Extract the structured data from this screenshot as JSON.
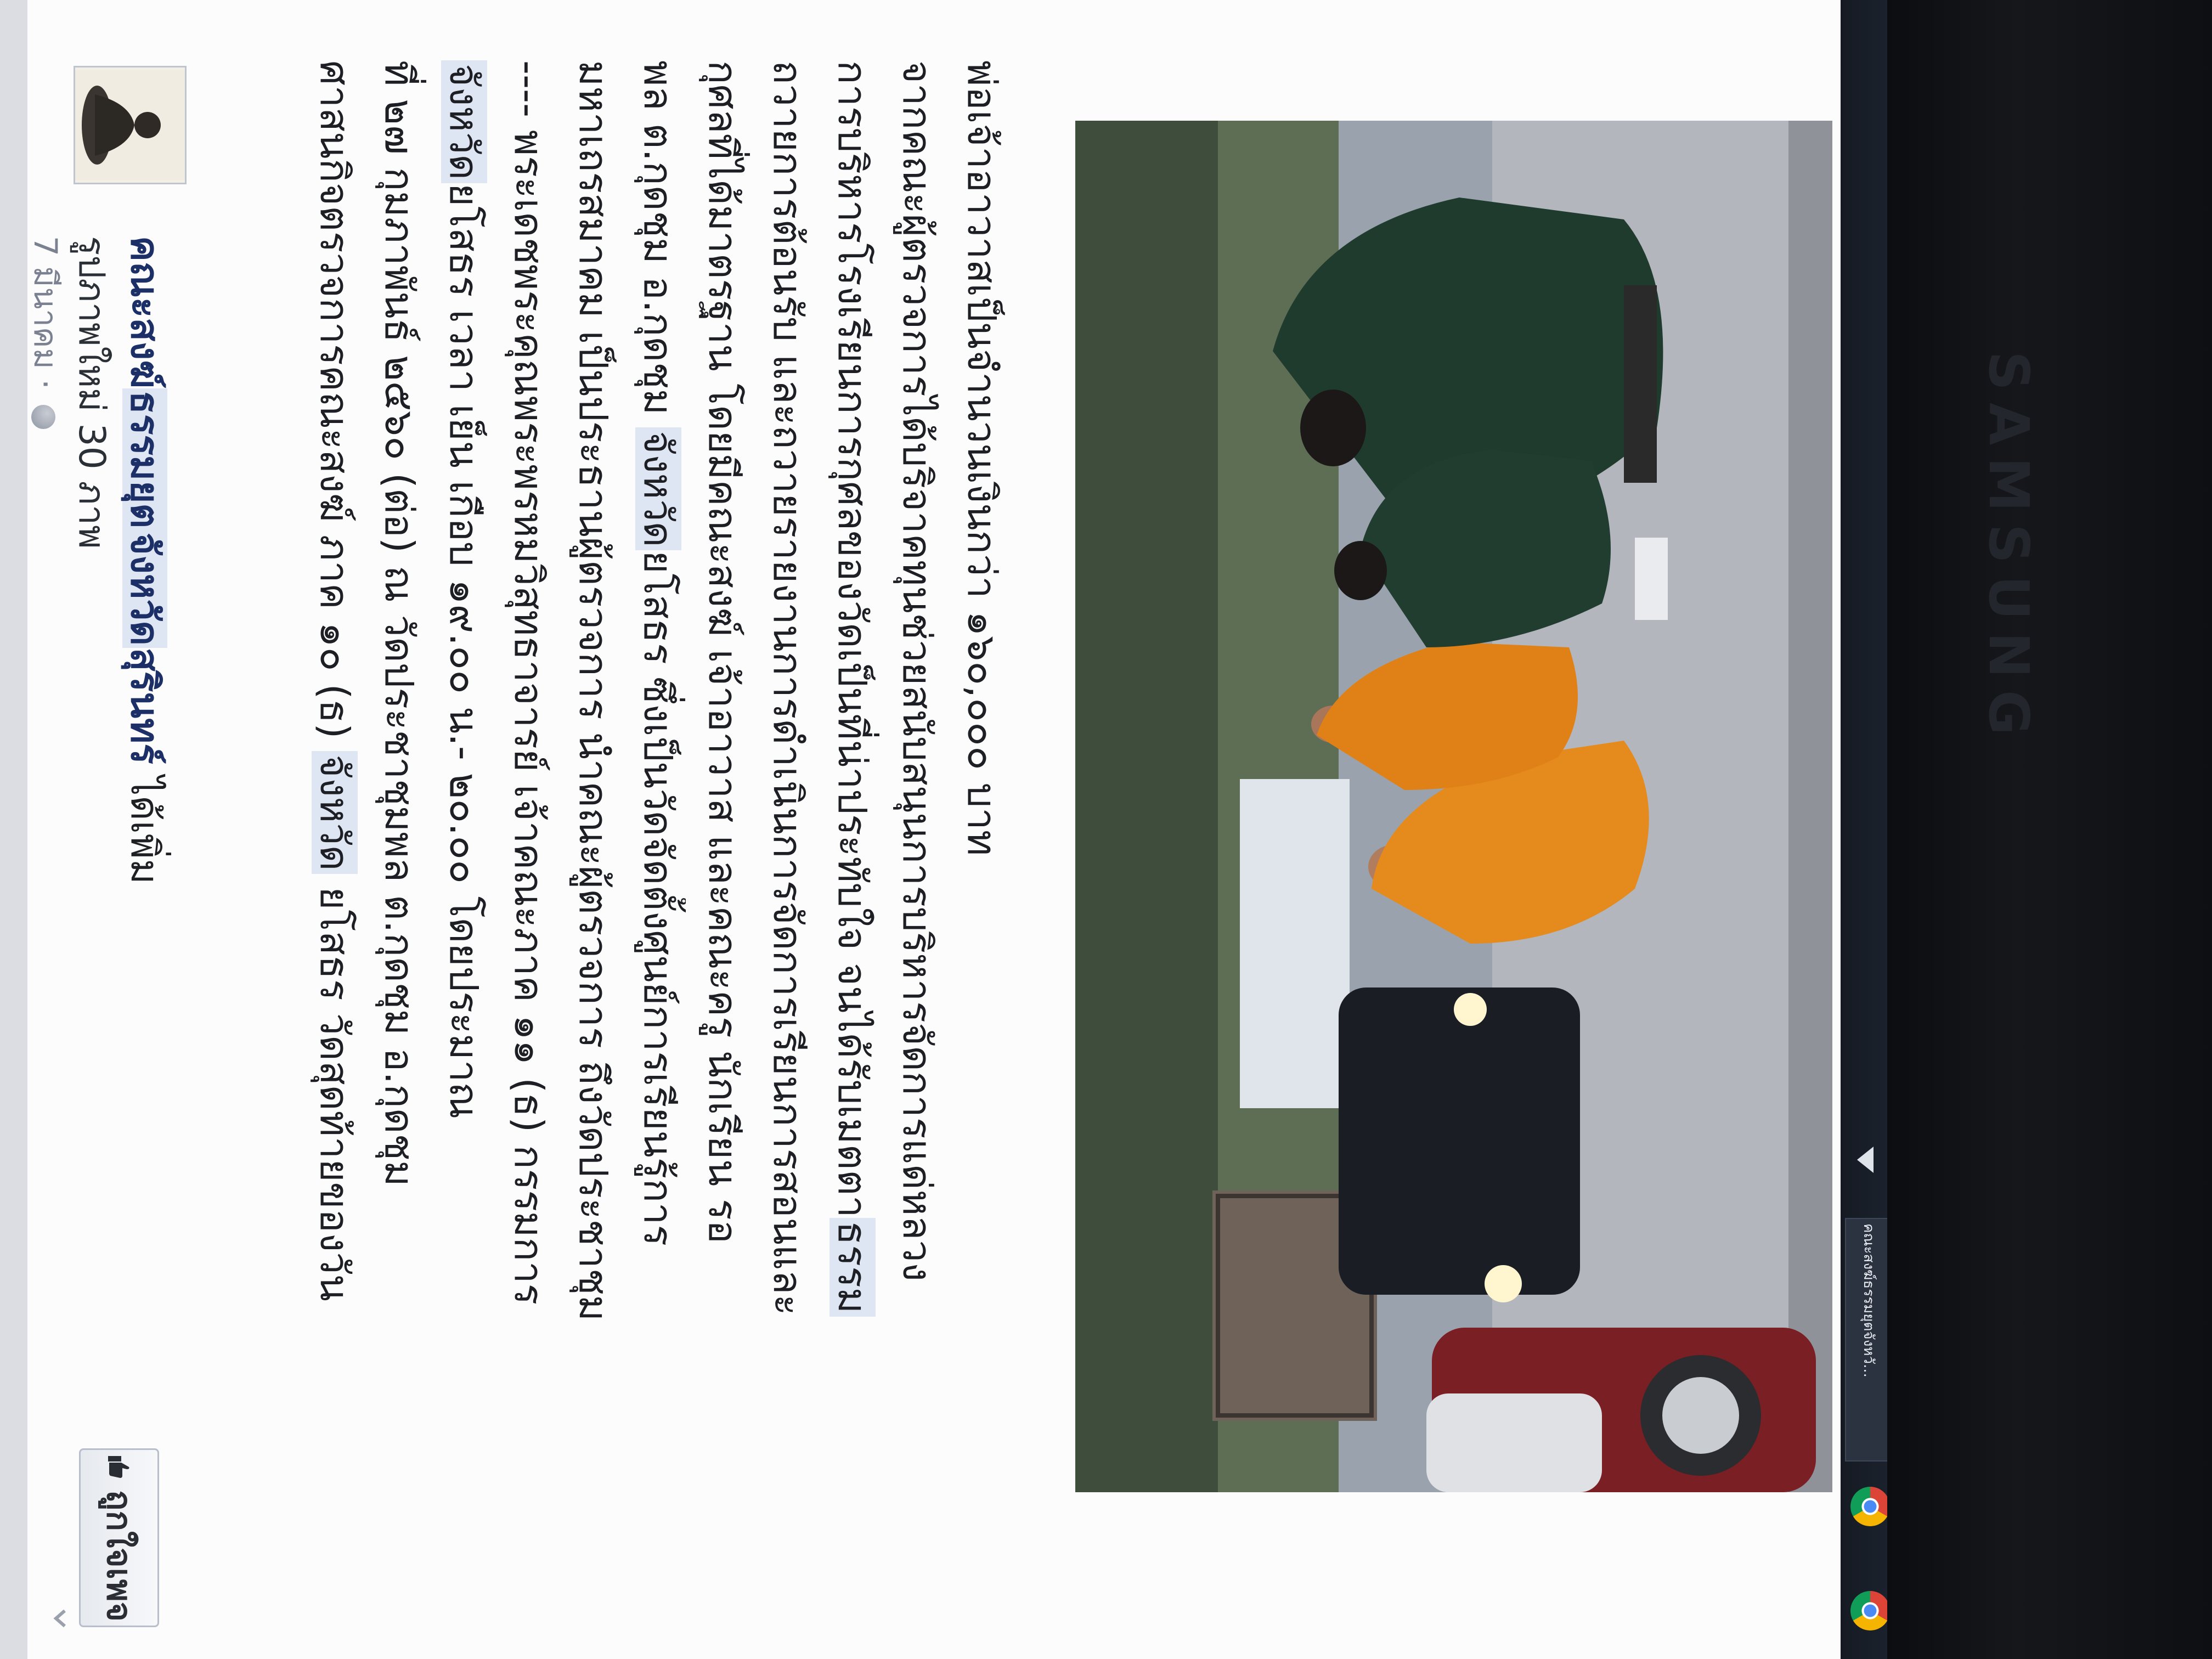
{
  "page": {
    "name_part1": "คณะสงฆ์",
    "name_part2": "ธรรมยุต",
    "name_part3": "จังหวัด",
    "name_part4": "สุรินทร์",
    "name_suffix": " ได้เพิ่ม",
    "photos_added": "รูปภาพใหม่ 30 ภาพ",
    "post_date": "7 มีนาคม ·",
    "like_button_label": "ถูกใจเพจ"
  },
  "post_body": {
    "lines": [
      {
        "pre": "ศาสนกิจตรวจการคณะสงฆ์ ภาค ๑๐ (ธ) ",
        "hl": "จังหวัด",
        "post": " ยโสธร วัดสุดท้ายของวัน"
      },
      {
        "pre": "ที่ ๒๗ กุมภาพันธ์ ๒๕๖๐ (ต่อ) ณ วัดประชาชุมพล ต.กุดชุม อ.กุดชุม",
        "hl": "",
        "post": ""
      },
      {
        "pre": "",
        "hl": "จังหวัด",
        "post": "ยโสธร เวลา เย็น เกือบ ๑๙.๐๐ น.- ๒๐.๐๐ โดยประมาณ"
      },
      {
        "pre": "---- พระเดชพระคุณพระพรหมวิสุทธาจารย์ เจ้าคณะภาค ๑๑ (ธ) กรรมการ",
        "hl": "",
        "post": ""
      },
      {
        "pre": "มหาเถรสมาคม เป็นประธานผู้ตรวจการ นำคณะผู้ตรวจการ ถึงวัดประชาชุม",
        "hl": "",
        "post": ""
      },
      {
        "pre": "พล ต.กุดชุม อ.กุดชุม ",
        "hl": "จังหวัด",
        "post": "ยโสธร ซึ่งเป็นวัดจัดตั้งศูนย์การเรียนรู้การ"
      },
      {
        "pre": "กุศลที่ได้มาตรฐาน โดยมีคณะสงฆ์ เจ้าอาวาส และคณะครู นักเรียน รอ",
        "hl": "",
        "post": ""
      },
      {
        "pre": "ถวายการต้อนรับ และถวายรายงานการดำเนินการจัดการเรียนการสอนและ",
        "hl": "",
        "post": ""
      },
      {
        "pre": "การบริหารโรงเรียนการกุศลของวัดเป็นที่น่าประทับใจ จนได้รับเมตตา",
        "hl": "ธรรม",
        "post": ""
      },
      {
        "pre": "จากคณะผู้ตรวจการได้บริจาคทุนช่วยสนับสนุนการบริหารจัดการแด่หลวง",
        "hl": "",
        "post": ""
      },
      {
        "pre": "พ่อเจ้าอาวาสเป็นจำนวนเงินกว่า ๑๖๐,๐๐๐ บาท",
        "hl": "",
        "post": ""
      }
    ]
  },
  "taskbar": {
    "active_tab_label": "คณะสงฆ์ธรรมยุตจังหวั..."
  },
  "monitor": {
    "brand": "SAMSUNG"
  },
  "colors": {
    "link": "#1c2f66",
    "highlight": "#dfe6f3",
    "robe": "#e58a1c",
    "uniform": "#1f3b2e"
  }
}
